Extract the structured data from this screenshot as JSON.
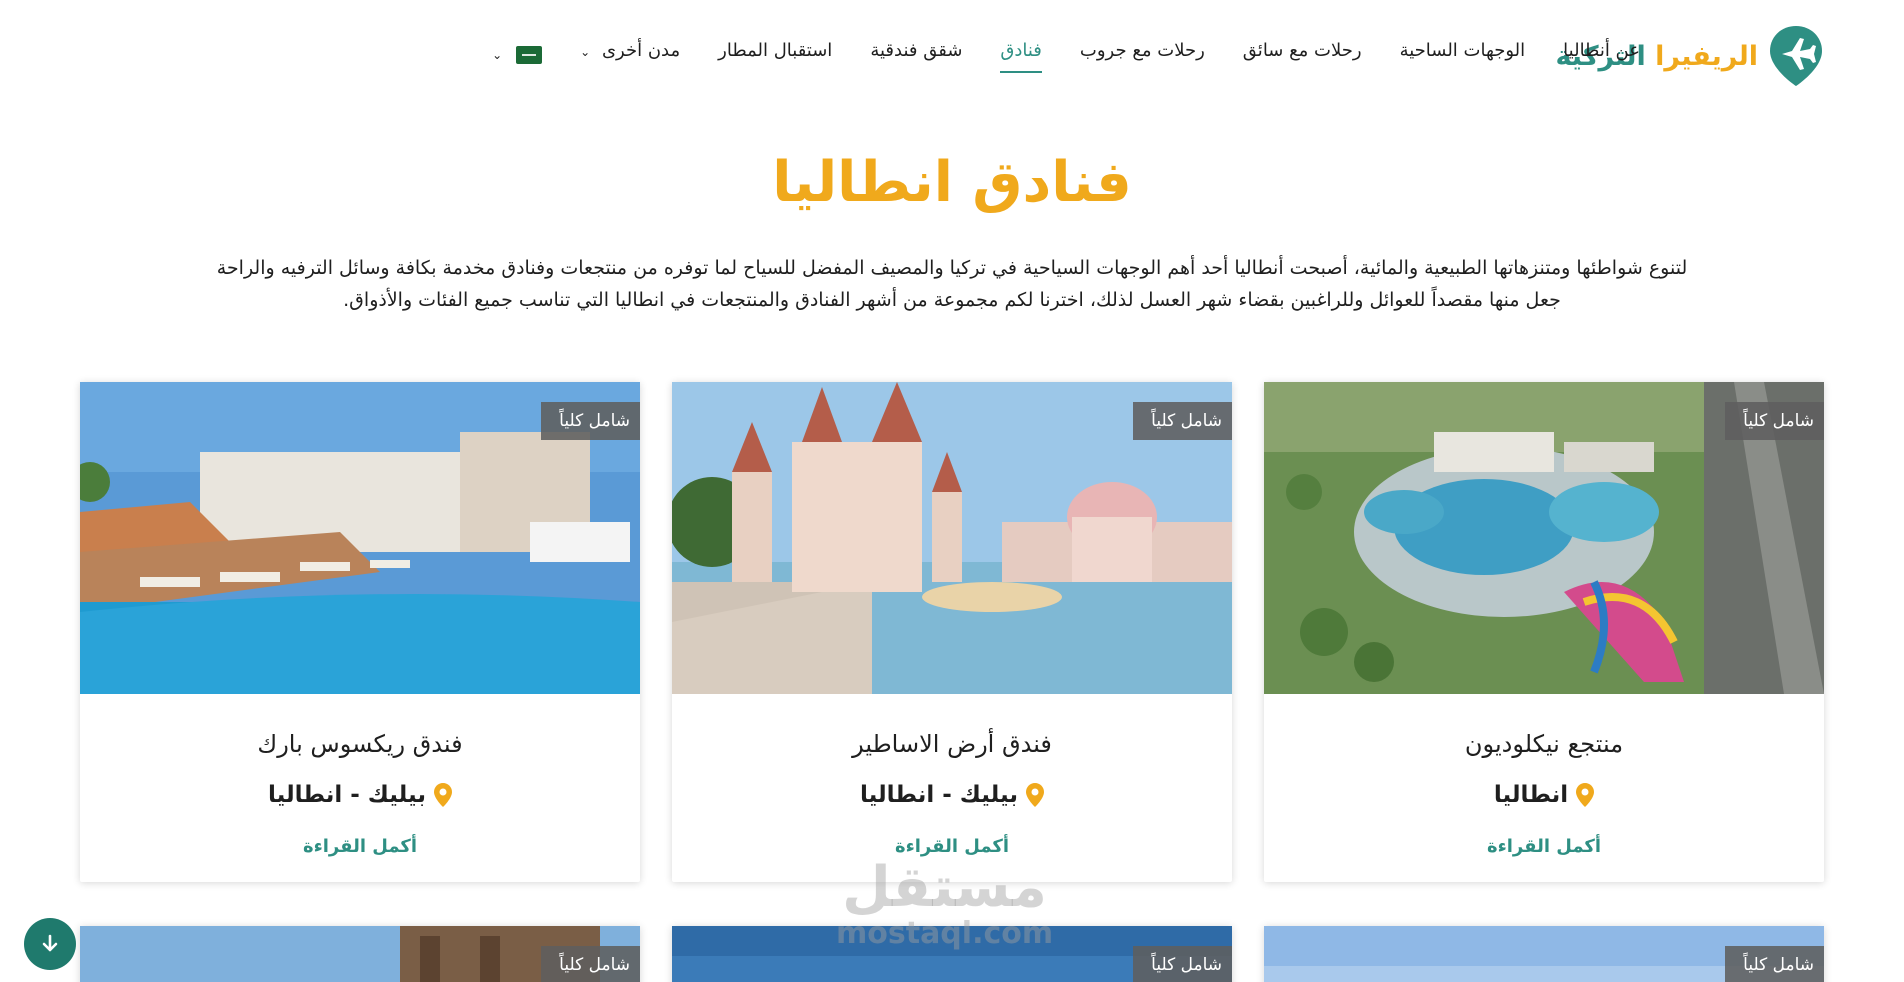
{
  "brand": {
    "name_part1": "الريفيرا",
    "name_part2": "التركية",
    "primary": "#2e8f83",
    "accent": "#f0a91c"
  },
  "nav": {
    "items": [
      {
        "label": "عن أنطاليا",
        "active": false
      },
      {
        "label": "الوجهات الساحية",
        "active": false
      },
      {
        "label": "رحلات مع سائق",
        "active": false
      },
      {
        "label": "رحلات مع جروب",
        "active": false
      },
      {
        "label": "فنادق",
        "active": true
      },
      {
        "label": "شقق فندقية",
        "active": false
      },
      {
        "label": "استقبال المطار",
        "active": false
      },
      {
        "label": "مدن أخرى",
        "active": false,
        "dropdown": true
      }
    ],
    "language_icon": "saudi-flag-icon"
  },
  "page": {
    "title": "فنادق انطاليا",
    "intro_line1": "لتنوع شواطئها ومتنزهاتها الطبيعية والمائية، أصبحت أنطاليا أحد أهم الوجهات السياحية في تركيا والمصيف المفضل للسياح لما توفره من منتجعات وفنادق مخدمة بكافة وسائل الترفيه والراحة",
    "intro_line2": "جعل منها مقصداً للعوائل وللراغبين بقضاء شهر العسل لذلك، اخترنا لكم مجموعة من أشهر الفنادق والمنتجعات في انطاليا التي تناسب جميع الفئات والأذواق."
  },
  "cards": [
    {
      "badge": "شامل كلياً",
      "title": "منتجع نيكلوديون",
      "location": "انطاليا",
      "more": "أكمل القراءة"
    },
    {
      "badge": "شامل كلياً",
      "title": "فندق أرض الاساطير",
      "location": "بيليك - انطاليا",
      "more": "أكمل القراءة"
    },
    {
      "badge": "شامل كلياً",
      "title": "فندق ريكسوس بارك",
      "location": "بيليك - انطاليا",
      "more": "أكمل القراءة"
    }
  ],
  "cards_row2": [
    {
      "badge": "شامل كلياً"
    },
    {
      "badge": "شامل كلياً"
    },
    {
      "badge": "شامل كلياً"
    }
  ],
  "watermark": {
    "line1": "مستقل",
    "line2": "mostaql.com"
  }
}
